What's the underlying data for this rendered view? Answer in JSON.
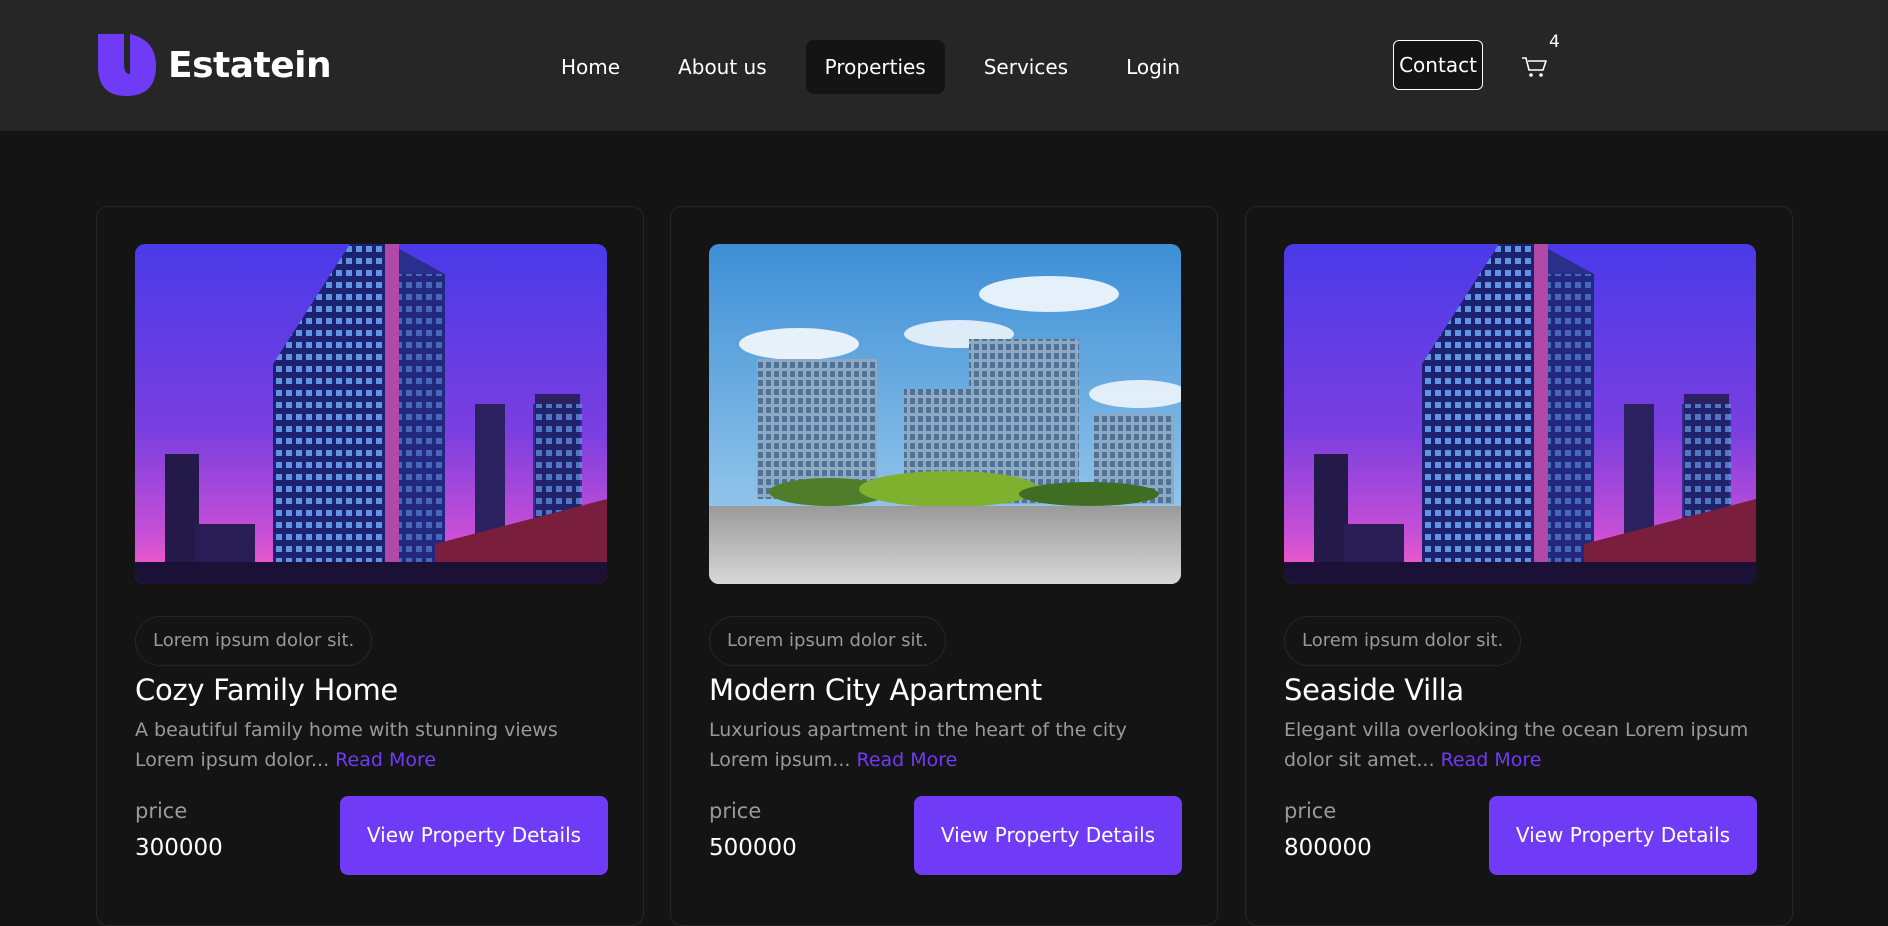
{
  "brand": {
    "name": "Estatein",
    "accent": "#703bf7"
  },
  "nav": [
    {
      "label": "Home"
    },
    {
      "label": "About us"
    },
    {
      "label": "Properties"
    },
    {
      "label": "Services"
    },
    {
      "label": "Login"
    }
  ],
  "header": {
    "contact_label": "Contact",
    "cart_icon": "cart-icon",
    "cart_count": "4"
  },
  "properties": [
    {
      "image": "purple-city-skyscraper",
      "tag": "Lorem ipsum dolor sit.",
      "title": "Cozy Family Home",
      "description": "A beautiful family home with stunning views Lorem ipsum dolor...",
      "read_more": "Read More",
      "price_label": "price",
      "price": "300000",
      "button_label": "View Property Details"
    },
    {
      "image": "daytime-office-buildings",
      "tag": "Lorem ipsum dolor sit.",
      "title": "Modern City Apartment",
      "description": "Luxurious apartment in the heart of the city Lorem ipsum...",
      "read_more": "Read More",
      "price_label": "price",
      "price": "500000",
      "button_label": "View Property Details"
    },
    {
      "image": "purple-city-skyscraper",
      "tag": "Lorem ipsum dolor sit.",
      "title": "Seaside Villa",
      "description": "Elegant villa overlooking the ocean Lorem ipsum dolor sit amet...",
      "read_more": "Read More",
      "price_label": "price",
      "price": "800000",
      "button_label": "View Property Details"
    }
  ]
}
